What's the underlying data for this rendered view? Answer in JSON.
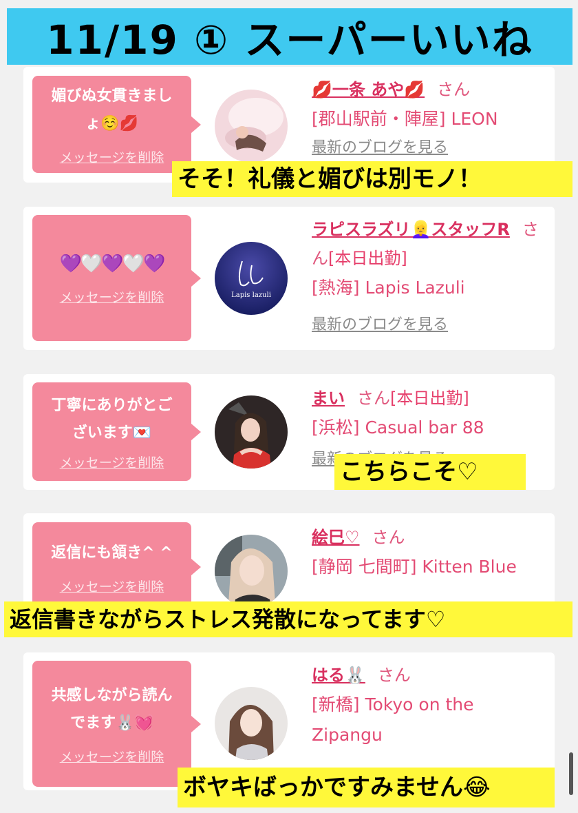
{
  "title": "11/19 ① スーパーいいね",
  "delete_label": "メッセージを削除",
  "blog_label": "最新のブログを見る",
  "san": "さん",
  "cards": [
    {
      "message": "媚びぬ女貫きまし\nょ☺️💋",
      "name": "💋一条 あや💋",
      "status": "",
      "shop": "[郡山駅前・陣屋] LEON",
      "avatar": "pink-room-photo"
    },
    {
      "message": "💜🤍💜🤍💜",
      "name": "ラピスラズリ👱‍♀️スタッフR",
      "status": "[本日出勤]",
      "shop": "[熱海] Lapis Lazuli",
      "avatar_logo": "Lapis lazuli"
    },
    {
      "message": "丁寧にありがとご\nざいます💌",
      "name": "まい",
      "status": "[本日出勤]",
      "shop": "[浜松] Casual bar 88",
      "avatar": "woman-red-dress-photo"
    },
    {
      "message": "返信にも頷き^ ^",
      "name": "絵巳♡",
      "status": "",
      "shop": "[静岡 七間町] Kitten Blue",
      "avatar": "woman-selfie-photo"
    },
    {
      "message": "共感しながら読ん\nでます🐰💓",
      "name": "はる🐰",
      "status": "",
      "shop": "[新橋] Tokyo on the Zipangu",
      "avatar": "woman-portrait-photo"
    }
  ],
  "captions": [
    "そそ！礼儀と媚びは別モノ！",
    "こちらこそ♡",
    "返信書きながらストレス発散になってます♡",
    "ボヤキばっかですみません😂"
  ],
  "colors": {
    "title_bg": "#3fc9f0",
    "bubble_bg": "#f4899c",
    "name_color": "#d9305f",
    "caption_bg": "#fff83a"
  }
}
